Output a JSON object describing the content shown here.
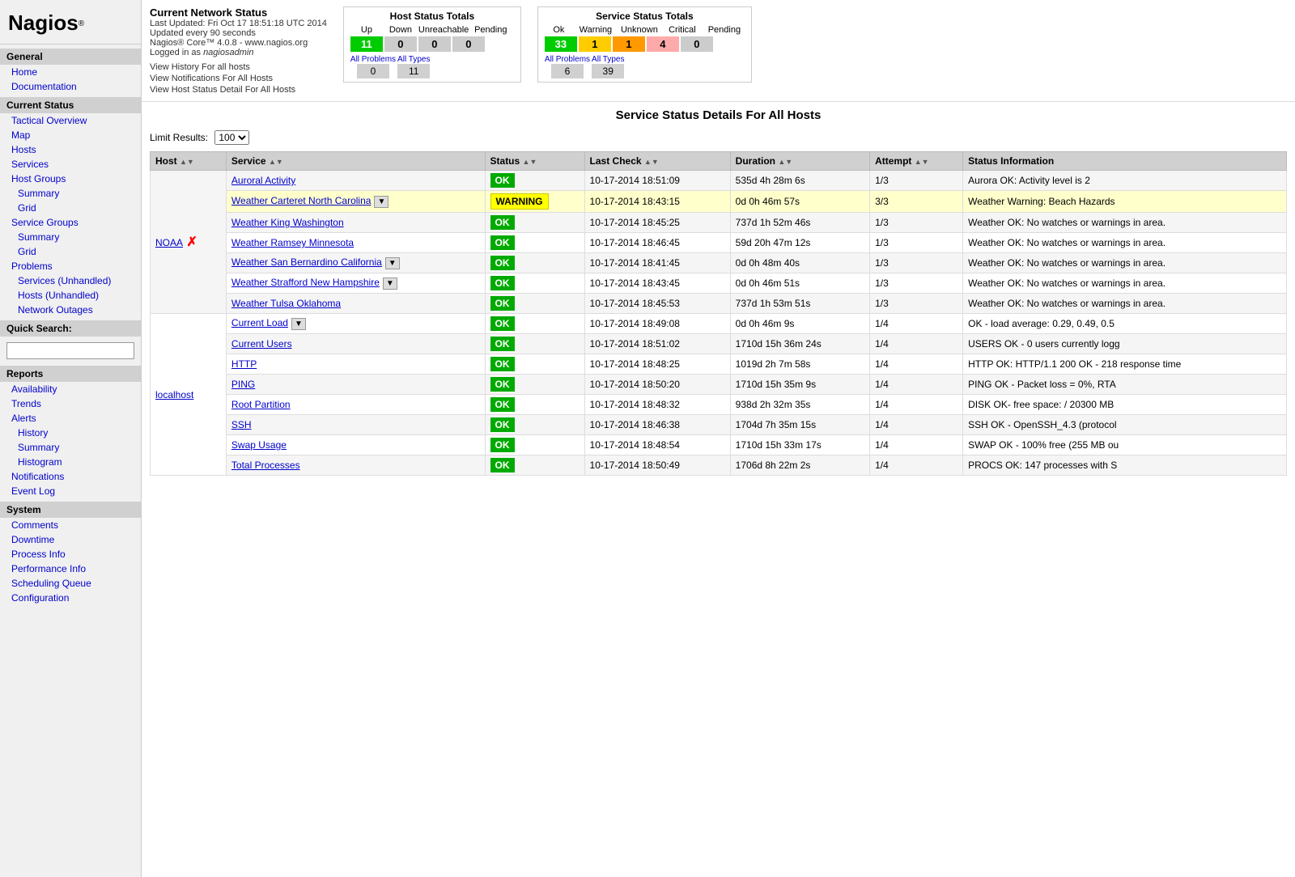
{
  "sidebar": {
    "logo": "Nagios",
    "logo_reg": "®",
    "sections": [
      {
        "header": "General",
        "links": [
          {
            "label": "Home",
            "indent": false
          },
          {
            "label": "Documentation",
            "indent": false
          }
        ]
      },
      {
        "header": "Current Status",
        "links": [
          {
            "label": "Tactical Overview",
            "indent": false
          },
          {
            "label": "Map",
            "indent": false
          },
          {
            "label": "Hosts",
            "indent": false
          },
          {
            "label": "Services",
            "indent": false
          },
          {
            "label": "Host Groups",
            "indent": false
          },
          {
            "label": "Summary",
            "indent": true
          },
          {
            "label": "Grid",
            "indent": true
          },
          {
            "label": "Service Groups",
            "indent": false
          },
          {
            "label": "Summary",
            "indent": true
          },
          {
            "label": "Grid",
            "indent": true
          },
          {
            "label": "Problems",
            "indent": false
          },
          {
            "label": "Services (Unhandled)",
            "indent": true
          },
          {
            "label": "Hosts (Unhandled)",
            "indent": true
          },
          {
            "label": "Network Outages",
            "indent": true
          }
        ]
      },
      {
        "header": "Quick Search",
        "links": []
      },
      {
        "header": "Reports",
        "links": [
          {
            "label": "Availability",
            "indent": false
          },
          {
            "label": "Trends",
            "indent": false
          },
          {
            "label": "Alerts",
            "indent": false
          },
          {
            "label": "History",
            "indent": true
          },
          {
            "label": "Summary",
            "indent": true
          },
          {
            "label": "Histogram",
            "indent": true
          },
          {
            "label": "Notifications",
            "indent": false
          },
          {
            "label": "Event Log",
            "indent": false
          }
        ]
      },
      {
        "header": "System",
        "links": [
          {
            "label": "Comments",
            "indent": false
          },
          {
            "label": "Downtime",
            "indent": false
          },
          {
            "label": "Process Info",
            "indent": false
          },
          {
            "label": "Performance Info",
            "indent": false
          },
          {
            "label": "Scheduling Queue",
            "indent": false
          },
          {
            "label": "Configuration",
            "indent": false
          }
        ]
      }
    ]
  },
  "header": {
    "title": "Current Network Status",
    "last_updated": "Last Updated: Fri Oct 17 18:51:18 UTC 2014",
    "update_interval": "Updated every 90 seconds",
    "version": "Nagios® Core™ 4.0.8 - www.nagios.org",
    "logged_in": "Logged in as nagiosadmin",
    "links": [
      "View History For all hosts",
      "View Notifications For All Hosts",
      "View Host Status Detail For All Hosts"
    ]
  },
  "host_status_totals": {
    "title": "Host Status Totals",
    "headers": [
      "Up",
      "Down",
      "Unreachable",
      "Pending"
    ],
    "values": [
      "11",
      "0",
      "0",
      "0"
    ],
    "colors": [
      "green",
      "gray",
      "gray",
      "gray"
    ],
    "all_problems_label": "All Problems",
    "all_types_label": "All Types",
    "all_problems_value": "0",
    "all_types_value": "11"
  },
  "service_status_totals": {
    "title": "Service Status Totals",
    "headers": [
      "Ok",
      "Warning",
      "Unknown",
      "Critical",
      "Pending"
    ],
    "values": [
      "33",
      "1",
      "1",
      "4",
      "0"
    ],
    "colors": [
      "green",
      "yellow",
      "orange",
      "red",
      "gray"
    ],
    "all_problems_label": "All Problems",
    "all_types_label": "All Types",
    "all_problems_value": "6",
    "all_types_value": "39"
  },
  "main": {
    "page_title": "Service Status Details For All Hosts",
    "limit_label": "Limit Results:",
    "limit_value": "100",
    "columns": [
      "Host",
      "Service",
      "Status",
      "Last Check",
      "Duration",
      "Attempt",
      "Status Information"
    ],
    "rows": [
      {
        "host": "NOAA",
        "host_has_x": true,
        "host_has_dropdown": false,
        "service": "Auroral Activity",
        "service_has_dropdown": false,
        "status": "OK",
        "last_check": "10-17-2014 18:51:09",
        "duration": "535d 4h 28m 6s",
        "attempt": "1/3",
        "info": "Aurora OK: Activity level is 2",
        "row_class": "row-odd",
        "status_class": "status-ok"
      },
      {
        "host": "",
        "host_has_x": false,
        "host_has_dropdown": false,
        "service": "Weather Carteret North Carolina",
        "service_has_dropdown": true,
        "status": "WARNING",
        "last_check": "10-17-2014 18:43:15",
        "duration": "0d 0h 46m 57s",
        "attempt": "3/3",
        "info": "Weather Warning: Beach Hazards",
        "row_class": "row-warning",
        "status_class": "status-warning"
      },
      {
        "host": "",
        "host_has_x": false,
        "host_has_dropdown": false,
        "service": "Weather King Washington",
        "service_has_dropdown": false,
        "status": "OK",
        "last_check": "10-17-2014 18:45:25",
        "duration": "737d 1h 52m 46s",
        "attempt": "1/3",
        "info": "Weather OK: No watches or warnings in area.",
        "row_class": "row-odd",
        "status_class": "status-ok"
      },
      {
        "host": "",
        "host_has_x": false,
        "host_has_dropdown": false,
        "service": "Weather Ramsey Minnesota",
        "service_has_dropdown": false,
        "status": "OK",
        "last_check": "10-17-2014 18:46:45",
        "duration": "59d 20h 47m 12s",
        "attempt": "1/3",
        "info": "Weather OK: No watches or warnings in area.",
        "row_class": "row-even",
        "status_class": "status-ok"
      },
      {
        "host": "",
        "host_has_x": false,
        "host_has_dropdown": false,
        "service": "Weather San Bernardino California",
        "service_has_dropdown": true,
        "status": "OK",
        "last_check": "10-17-2014 18:41:45",
        "duration": "0d 0h 48m 40s",
        "attempt": "1/3",
        "info": "Weather OK: No watches or warnings in area.",
        "row_class": "row-odd",
        "status_class": "status-ok"
      },
      {
        "host": "",
        "host_has_x": false,
        "host_has_dropdown": false,
        "service": "Weather Strafford New Hampshire",
        "service_has_dropdown": true,
        "status": "OK",
        "last_check": "10-17-2014 18:43:45",
        "duration": "0d 0h 46m 51s",
        "attempt": "1/3",
        "info": "Weather OK: No watches or warnings in area.",
        "row_class": "row-even",
        "status_class": "status-ok"
      },
      {
        "host": "",
        "host_has_x": false,
        "host_has_dropdown": false,
        "service": "Weather Tulsa Oklahoma",
        "service_has_dropdown": false,
        "status": "OK",
        "last_check": "10-17-2014 18:45:53",
        "duration": "737d 1h 53m 51s",
        "attempt": "1/3",
        "info": "Weather OK: No watches or warnings in area.",
        "row_class": "row-odd",
        "status_class": "status-ok"
      },
      {
        "host": "localhost",
        "host_has_x": false,
        "host_has_dropdown": false,
        "service": "Current Load",
        "service_has_dropdown": true,
        "status": "OK",
        "last_check": "10-17-2014 18:49:08",
        "duration": "0d 0h 46m 9s",
        "attempt": "1/4",
        "info": "OK - load average: 0.29, 0.49, 0.5",
        "row_class": "row-even",
        "status_class": "status-ok"
      },
      {
        "host": "",
        "host_has_x": false,
        "host_has_dropdown": false,
        "service": "Current Users",
        "service_has_dropdown": false,
        "status": "OK",
        "last_check": "10-17-2014 18:51:02",
        "duration": "1710d 15h 36m 24s",
        "attempt": "1/4",
        "info": "USERS OK - 0 users currently logg",
        "row_class": "row-odd",
        "status_class": "status-ok"
      },
      {
        "host": "",
        "host_has_x": false,
        "host_has_dropdown": false,
        "service": "HTTP",
        "service_has_dropdown": false,
        "status": "OK",
        "last_check": "10-17-2014 18:48:25",
        "duration": "1019d 2h 7m 58s",
        "attempt": "1/4",
        "info": "HTTP OK: HTTP/1.1 200 OK - 218 response time",
        "row_class": "row-even",
        "status_class": "status-ok"
      },
      {
        "host": "",
        "host_has_x": false,
        "host_has_dropdown": false,
        "service": "PING",
        "service_has_dropdown": false,
        "status": "OK",
        "last_check": "10-17-2014 18:50:20",
        "duration": "1710d 15h 35m 9s",
        "attempt": "1/4",
        "info": "PING OK - Packet loss = 0%, RTA",
        "row_class": "row-odd",
        "status_class": "status-ok"
      },
      {
        "host": "",
        "host_has_x": false,
        "host_has_dropdown": false,
        "service": "Root Partition",
        "service_has_dropdown": false,
        "status": "OK",
        "last_check": "10-17-2014 18:48:32",
        "duration": "938d 2h 32m 35s",
        "attempt": "1/4",
        "info": "DISK OK- free space: / 20300 MB",
        "row_class": "row-even",
        "status_class": "status-ok"
      },
      {
        "host": "",
        "host_has_x": false,
        "host_has_dropdown": false,
        "service": "SSH",
        "service_has_dropdown": false,
        "status": "OK",
        "last_check": "10-17-2014 18:46:38",
        "duration": "1704d 7h 35m 15s",
        "attempt": "1/4",
        "info": "SSH OK - OpenSSH_4.3 (protocol",
        "row_class": "row-odd",
        "status_class": "status-ok"
      },
      {
        "host": "",
        "host_has_x": false,
        "host_has_dropdown": false,
        "service": "Swap Usage",
        "service_has_dropdown": false,
        "status": "OK",
        "last_check": "10-17-2014 18:48:54",
        "duration": "1710d 15h 33m 17s",
        "attempt": "1/4",
        "info": "SWAP OK - 100% free (255 MB ou",
        "row_class": "row-even",
        "status_class": "status-ok"
      },
      {
        "host": "",
        "host_has_x": false,
        "host_has_dropdown": false,
        "service": "Total Processes",
        "service_has_dropdown": false,
        "status": "OK",
        "last_check": "10-17-2014 18:50:49",
        "duration": "1706d 8h 22m 2s",
        "attempt": "1/4",
        "info": "PROCS OK: 147 processes with S",
        "row_class": "row-odd",
        "status_class": "status-ok"
      }
    ]
  }
}
